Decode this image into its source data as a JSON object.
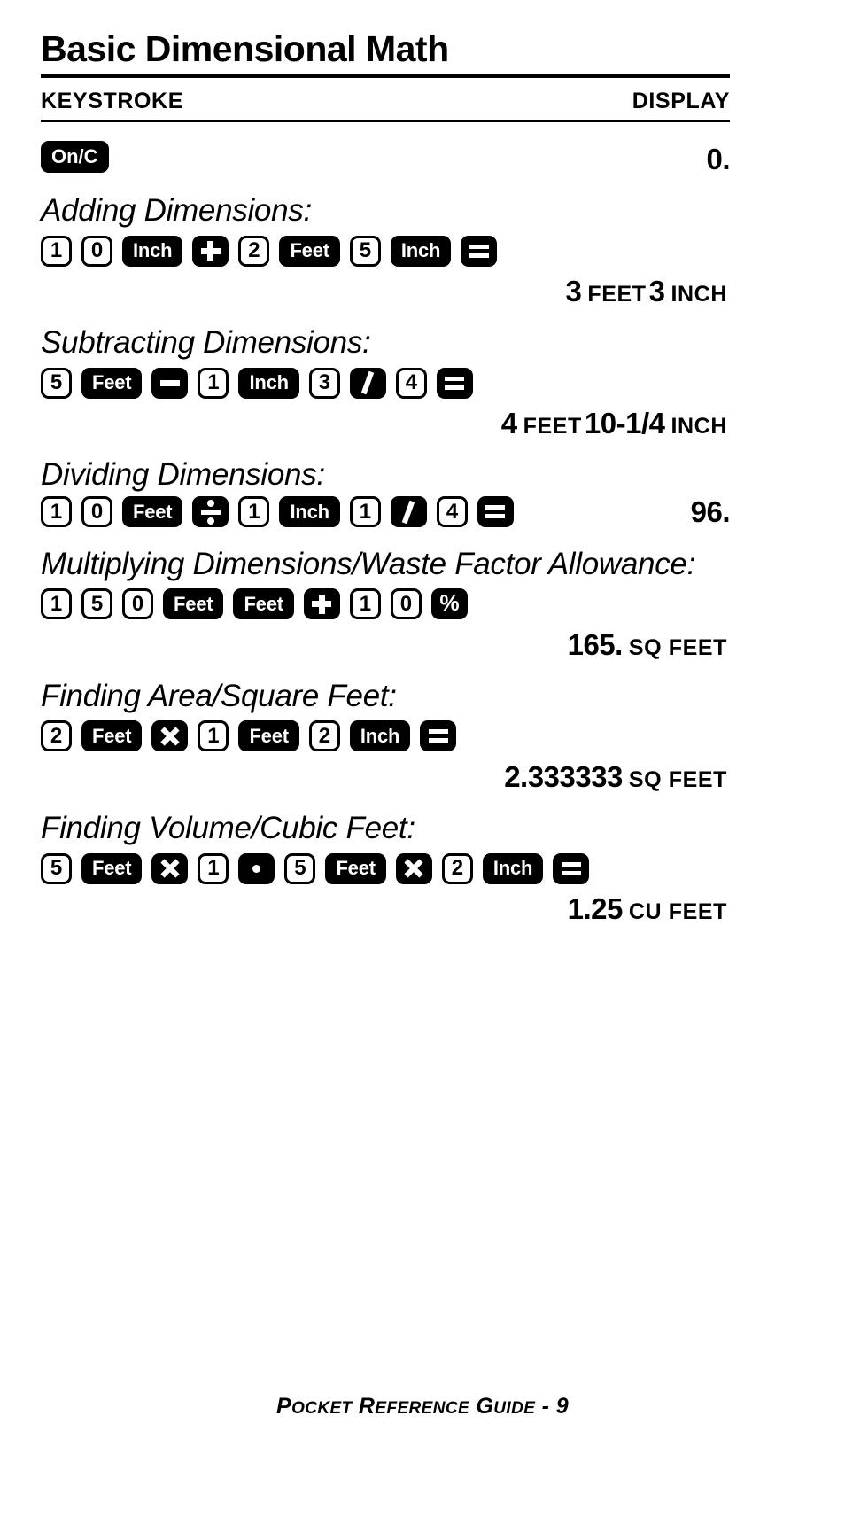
{
  "header": {
    "title": "Basic Dimensional Math",
    "col_keystroke": "KEYSTROKE",
    "col_display": "DISPLAY"
  },
  "power": {
    "key_label": "On/C",
    "display_value": "0."
  },
  "sections": [
    {
      "title": "Adding Dimensions:",
      "keys": [
        {
          "type": "num",
          "label": "1"
        },
        {
          "type": "num",
          "label": "0"
        },
        {
          "type": "fn",
          "label": "Inch"
        },
        {
          "type": "sym",
          "label": "plus-icon"
        },
        {
          "type": "num",
          "label": "2"
        },
        {
          "type": "fn",
          "label": "Feet"
        },
        {
          "type": "num",
          "label": "5"
        },
        {
          "type": "fn",
          "label": "Inch"
        },
        {
          "type": "sym",
          "label": "equals-icon"
        }
      ],
      "result": [
        {
          "value": "3",
          "unit": "FEET"
        },
        {
          "value": "3",
          "unit": "INCH"
        }
      ],
      "inline_result": false
    },
    {
      "title": "Subtracting Dimensions:",
      "keys": [
        {
          "type": "num",
          "label": "5"
        },
        {
          "type": "fn",
          "label": "Feet"
        },
        {
          "type": "sym",
          "label": "minus-icon"
        },
        {
          "type": "num",
          "label": "1"
        },
        {
          "type": "fn",
          "label": "Inch"
        },
        {
          "type": "num",
          "label": "3"
        },
        {
          "type": "sym",
          "label": "slash-icon"
        },
        {
          "type": "num",
          "label": "4"
        },
        {
          "type": "sym",
          "label": "equals-icon"
        }
      ],
      "result": [
        {
          "value": "4",
          "unit": "FEET"
        },
        {
          "value": "10-1/4",
          "unit": "INCH"
        }
      ],
      "inline_result": false
    },
    {
      "title": "Dividing Dimensions:",
      "keys": [
        {
          "type": "num",
          "label": "1"
        },
        {
          "type": "num",
          "label": "0"
        },
        {
          "type": "fn",
          "label": "Feet"
        },
        {
          "type": "sym",
          "label": "divide-icon"
        },
        {
          "type": "num",
          "label": "1"
        },
        {
          "type": "fn",
          "label": "Inch"
        },
        {
          "type": "num",
          "label": "1"
        },
        {
          "type": "sym",
          "label": "slash-icon"
        },
        {
          "type": "num",
          "label": "4"
        },
        {
          "type": "sym",
          "label": "equals-icon"
        }
      ],
      "result": [
        {
          "value": "96.",
          "unit": ""
        }
      ],
      "inline_result": true
    },
    {
      "title": "Multiplying Dimensions/Waste Factor Allowance:",
      "keys": [
        {
          "type": "num",
          "label": "1"
        },
        {
          "type": "num",
          "label": "5"
        },
        {
          "type": "num",
          "label": "0"
        },
        {
          "type": "fn",
          "label": "Feet"
        },
        {
          "type": "fn",
          "label": "Feet"
        },
        {
          "type": "sym",
          "label": "plus-icon"
        },
        {
          "type": "num",
          "label": "1"
        },
        {
          "type": "num",
          "label": "0"
        },
        {
          "type": "sym",
          "label": "percent-icon"
        }
      ],
      "result": [
        {
          "value": "165.",
          "unit": "SQ FEET"
        }
      ],
      "inline_result": false
    },
    {
      "title": "Finding Area/Square Feet:",
      "keys": [
        {
          "type": "num",
          "label": "2"
        },
        {
          "type": "fn",
          "label": "Feet"
        },
        {
          "type": "sym",
          "label": "times-icon"
        },
        {
          "type": "num",
          "label": "1"
        },
        {
          "type": "fn",
          "label": "Feet"
        },
        {
          "type": "num",
          "label": "2"
        },
        {
          "type": "fn",
          "label": "Inch"
        },
        {
          "type": "sym",
          "label": "equals-icon"
        }
      ],
      "result": [
        {
          "value": "2.333333",
          "unit": "SQ FEET"
        }
      ],
      "inline_result": false
    },
    {
      "title": "Finding Volume/Cubic Feet:",
      "keys": [
        {
          "type": "num",
          "label": "5"
        },
        {
          "type": "fn",
          "label": "Feet"
        },
        {
          "type": "sym",
          "label": "times-icon"
        },
        {
          "type": "num",
          "label": "1"
        },
        {
          "type": "sym",
          "label": "dot-icon"
        },
        {
          "type": "num",
          "label": "5"
        },
        {
          "type": "fn",
          "label": "Feet"
        },
        {
          "type": "sym",
          "label": "times-icon"
        },
        {
          "type": "num",
          "label": "2"
        },
        {
          "type": "fn",
          "label": "Inch"
        },
        {
          "type": "sym",
          "label": "equals-icon"
        }
      ],
      "result": [
        {
          "value": "1.25",
          "unit": "CU FEET"
        }
      ],
      "inline_result": false
    }
  ],
  "footer": {
    "text_lead": "P",
    "text": "OCKET",
    "full": "Pocket Reference Guide - 9",
    "words": [
      "Pocket",
      "Reference",
      "Guide",
      "- 9"
    ]
  },
  "colors": {
    "ink": "#000000",
    "paper": "#ffffff"
  }
}
